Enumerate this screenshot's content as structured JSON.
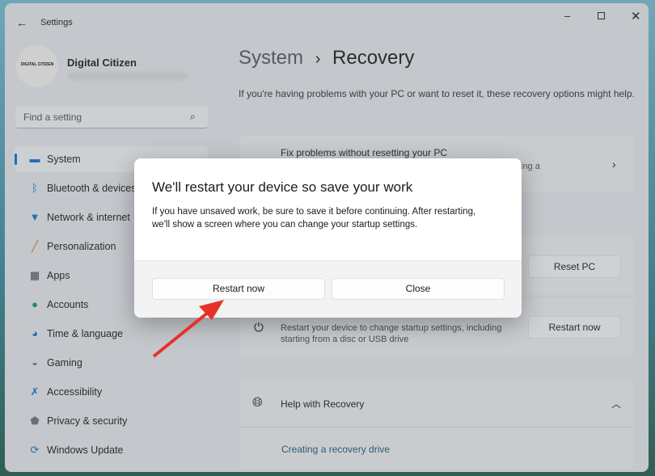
{
  "titlebar": {
    "back_icon": "arrow-left-icon",
    "title": "Settings",
    "minimize_icon": "minimize-icon",
    "maximize_icon": "maximize-icon",
    "close_icon": "close-icon"
  },
  "profile": {
    "avatar_text": "DIGITAL CITIZEN",
    "name": "Digital Citizen"
  },
  "search": {
    "placeholder": "Find a setting",
    "icon": "search-icon"
  },
  "sidebar": {
    "items": [
      {
        "label": "System",
        "icon": "monitor-icon",
        "color": "#1f6fb5",
        "selected": true
      },
      {
        "label": "Bluetooth & devices",
        "icon": "bluetooth-icon",
        "color": "#1f6fb5"
      },
      {
        "label": "Network & internet",
        "icon": "wifi-icon",
        "color": "#1f6fb5"
      },
      {
        "label": "Personalization",
        "icon": "brush-icon",
        "color": "#c86a2a"
      },
      {
        "label": "Apps",
        "icon": "apps-icon",
        "color": "#3d4a5a"
      },
      {
        "label": "Accounts",
        "icon": "person-icon",
        "color": "#1f8a6a"
      },
      {
        "label": "Time & language",
        "icon": "globe-clock-icon",
        "color": "#1f6fb5"
      },
      {
        "label": "Gaming",
        "icon": "gamepad-icon",
        "color": "#6a6f75"
      },
      {
        "label": "Accessibility",
        "icon": "accessibility-icon",
        "color": "#1f6fb5"
      },
      {
        "label": "Privacy & security",
        "icon": "shield-icon",
        "color": "#6a6f75"
      },
      {
        "label": "Windows Update",
        "icon": "update-icon",
        "color": "#1f6fb5"
      }
    ]
  },
  "main": {
    "breadcrumb_parent": "System",
    "breadcrumb_sep": "›",
    "breadcrumb_current": "Recovery",
    "description": "If you're having problems with your PC or want to reset it, these recovery options might help.",
    "fix_card": {
      "title": "Fix problems without resetting your PC",
      "subtitle_fragment": "ing a"
    },
    "reset_button": "Reset PC",
    "advanced": {
      "desc1": "Restart your device to change startup settings, including",
      "desc2": "starting from a disc or USB drive",
      "button": "Restart now"
    },
    "help": {
      "title": "Help with Recovery",
      "link": "Creating a recovery drive"
    }
  },
  "dialog": {
    "title": "We'll restart your device so save your work",
    "body1": "If you have unsaved work, be sure to save it before continuing. After restarting,",
    "body2": "we'll show a screen where you can change your startup settings.",
    "primary": "Restart now",
    "secondary": "Close"
  },
  "annotation": {
    "arrow_color": "#e8302a"
  }
}
